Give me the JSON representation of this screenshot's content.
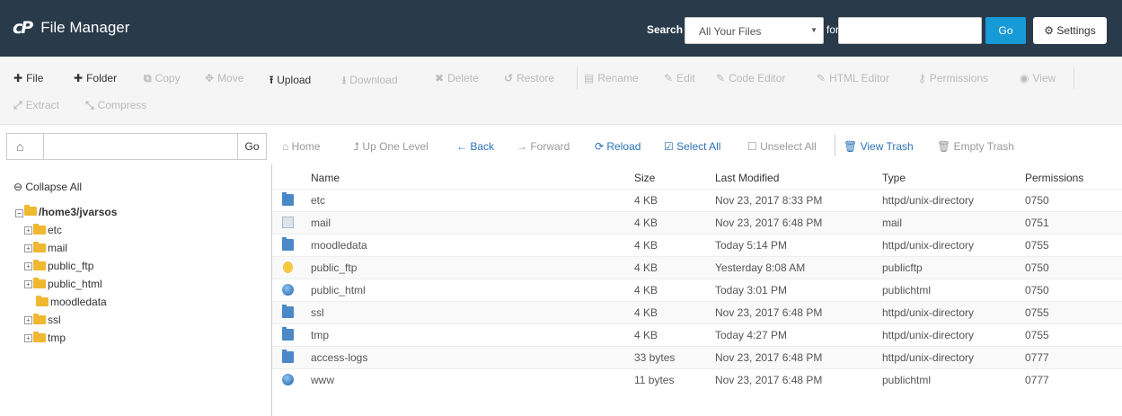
{
  "header": {
    "logo": "cP",
    "title": "File Manager",
    "search_label": "Search",
    "search_scope": "All Your Files",
    "for_label": "for",
    "search_value": "",
    "go_label": "Go",
    "settings_label": "Settings"
  },
  "toolbar": {
    "file": "File",
    "folder": "Folder",
    "copy": "Copy",
    "move": "Move",
    "upload": "Upload",
    "download": "Download",
    "delete": "Delete",
    "restore": "Restore",
    "rename": "Rename",
    "edit": "Edit",
    "code_editor": "Code Editor",
    "html_editor": "HTML Editor",
    "permissions": "Permissions",
    "view": "View",
    "extract": "Extract",
    "compress": "Compress"
  },
  "pathbar": {
    "value": "",
    "go_label": "Go"
  },
  "nav": {
    "home": "Home",
    "up": "Up One Level",
    "back": "Back",
    "forward": "Forward",
    "reload": "Reload",
    "select_all": "Select All",
    "unselect_all": "Unselect All",
    "view_trash": "View Trash",
    "empty_trash": "Empty Trash"
  },
  "sidebar": {
    "collapse_all": "Collapse All",
    "root": "/home3/jvarsos",
    "items": [
      {
        "label": "etc"
      },
      {
        "label": "mail"
      },
      {
        "label": "public_ftp"
      },
      {
        "label": "public_html"
      },
      {
        "label": "moodledata"
      },
      {
        "label": "ssl"
      },
      {
        "label": "tmp"
      }
    ]
  },
  "table": {
    "columns": {
      "name": "Name",
      "size": "Size",
      "modified": "Last Modified",
      "type": "Type",
      "perms": "Permissions"
    },
    "rows": [
      {
        "name": "etc",
        "size": "4 KB",
        "modified": "Nov 23, 2017 8:33 PM",
        "type": "httpd/unix-directory",
        "perms": "0750"
      },
      {
        "name": "mail",
        "size": "4 KB",
        "modified": "Nov 23, 2017 6:48 PM",
        "type": "mail",
        "perms": "0751"
      },
      {
        "name": "moodledata",
        "size": "4 KB",
        "modified": "Today 5:14 PM",
        "type": "httpd/unix-directory",
        "perms": "0755"
      },
      {
        "name": "public_ftp",
        "size": "4 KB",
        "modified": "Yesterday 8:08 AM",
        "type": "publicftp",
        "perms": "0750"
      },
      {
        "name": "public_html",
        "size": "4 KB",
        "modified": "Today 3:01 PM",
        "type": "publichtml",
        "perms": "0750"
      },
      {
        "name": "ssl",
        "size": "4 KB",
        "modified": "Nov 23, 2017 6:48 PM",
        "type": "httpd/unix-directory",
        "perms": "0755"
      },
      {
        "name": "tmp",
        "size": "4 KB",
        "modified": "Today 4:27 PM",
        "type": "httpd/unix-directory",
        "perms": "0755"
      },
      {
        "name": "access-logs",
        "size": "33 bytes",
        "modified": "Nov 23, 2017 6:48 PM",
        "type": "httpd/unix-directory",
        "perms": "0777"
      },
      {
        "name": "www",
        "size": "11 bytes",
        "modified": "Nov 23, 2017 6:48 PM",
        "type": "publichtml",
        "perms": "0777"
      }
    ]
  },
  "colors": {
    "header_bg": "#293a4a",
    "go_blue": "#179bd7",
    "link_blue": "#2a71b8"
  }
}
